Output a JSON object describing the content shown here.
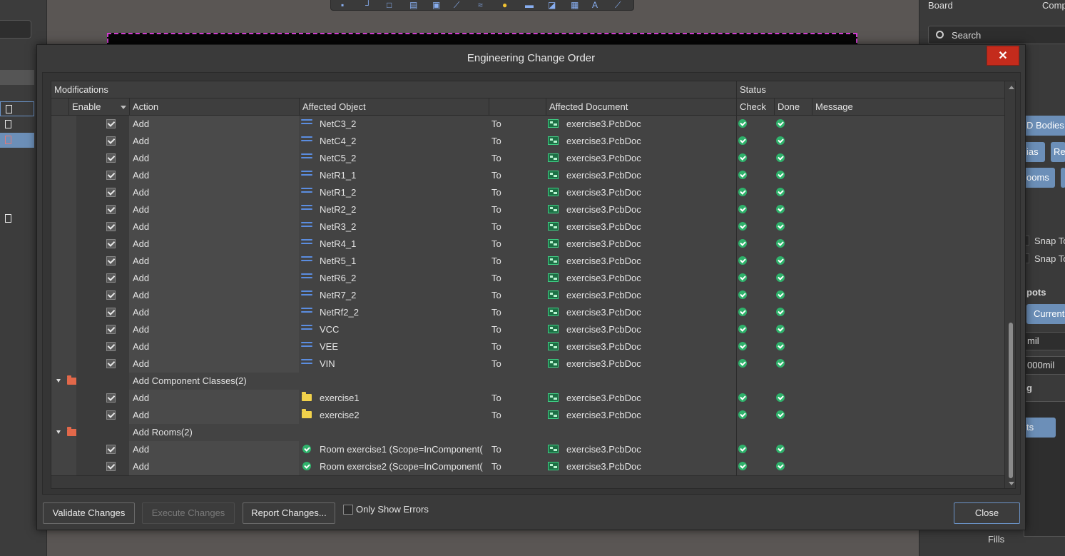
{
  "dialog": {
    "title": "Engineering Change Order",
    "close_x": "✕"
  },
  "columns": {
    "modifications": "Modifications",
    "status": "Status",
    "enable": "Enable",
    "action": "Action",
    "affected_object": "Affected Object",
    "affected_document": "Affected Document",
    "check": "Check",
    "done": "Done",
    "message": "Message"
  },
  "rows": [
    {
      "type": "item",
      "enabled": true,
      "action": "Add",
      "icon": "net-icon",
      "object": "NetC3_2",
      "to": "To",
      "document": "exercise3.PcbDoc",
      "check": "ok",
      "done": "ok"
    },
    {
      "type": "item",
      "enabled": true,
      "action": "Add",
      "icon": "net-icon",
      "object": "NetC4_2",
      "to": "To",
      "document": "exercise3.PcbDoc",
      "check": "ok",
      "done": "ok"
    },
    {
      "type": "item",
      "enabled": true,
      "action": "Add",
      "icon": "net-icon",
      "object": "NetC5_2",
      "to": "To",
      "document": "exercise3.PcbDoc",
      "check": "ok",
      "done": "ok"
    },
    {
      "type": "item",
      "enabled": true,
      "action": "Add",
      "icon": "net-icon",
      "object": "NetR1_1",
      "to": "To",
      "document": "exercise3.PcbDoc",
      "check": "ok",
      "done": "ok"
    },
    {
      "type": "item",
      "enabled": true,
      "action": "Add",
      "icon": "net-icon",
      "object": "NetR1_2",
      "to": "To",
      "document": "exercise3.PcbDoc",
      "check": "ok",
      "done": "ok"
    },
    {
      "type": "item",
      "enabled": true,
      "action": "Add",
      "icon": "net-icon",
      "object": "NetR2_2",
      "to": "To",
      "document": "exercise3.PcbDoc",
      "check": "ok",
      "done": "ok"
    },
    {
      "type": "item",
      "enabled": true,
      "action": "Add",
      "icon": "net-icon",
      "object": "NetR3_2",
      "to": "To",
      "document": "exercise3.PcbDoc",
      "check": "ok",
      "done": "ok"
    },
    {
      "type": "item",
      "enabled": true,
      "action": "Add",
      "icon": "net-icon",
      "object": "NetR4_1",
      "to": "To",
      "document": "exercise3.PcbDoc",
      "check": "ok",
      "done": "ok"
    },
    {
      "type": "item",
      "enabled": true,
      "action": "Add",
      "icon": "net-icon",
      "object": "NetR5_1",
      "to": "To",
      "document": "exercise3.PcbDoc",
      "check": "ok",
      "done": "ok"
    },
    {
      "type": "item",
      "enabled": true,
      "action": "Add",
      "icon": "net-icon",
      "object": "NetR6_2",
      "to": "To",
      "document": "exercise3.PcbDoc",
      "check": "ok",
      "done": "ok"
    },
    {
      "type": "item",
      "enabled": true,
      "action": "Add",
      "icon": "net-icon",
      "object": "NetR7_2",
      "to": "To",
      "document": "exercise3.PcbDoc",
      "check": "ok",
      "done": "ok"
    },
    {
      "type": "item",
      "enabled": true,
      "action": "Add",
      "icon": "net-icon",
      "object": "NetRf2_2",
      "to": "To",
      "document": "exercise3.PcbDoc",
      "check": "ok",
      "done": "ok"
    },
    {
      "type": "item",
      "enabled": true,
      "action": "Add",
      "icon": "net-icon",
      "object": "VCC",
      "to": "To",
      "document": "exercise3.PcbDoc",
      "check": "ok",
      "done": "ok"
    },
    {
      "type": "item",
      "enabled": true,
      "action": "Add",
      "icon": "net-icon",
      "object": "VEE",
      "to": "To",
      "document": "exercise3.PcbDoc",
      "check": "ok",
      "done": "ok"
    },
    {
      "type": "item",
      "enabled": true,
      "action": "Add",
      "icon": "net-icon",
      "object": "VIN",
      "to": "To",
      "document": "exercise3.PcbDoc",
      "check": "ok",
      "done": "ok"
    },
    {
      "type": "group",
      "label": "Add Component Classes(2)"
    },
    {
      "type": "item",
      "enabled": true,
      "action": "Add",
      "icon": "folder-icon",
      "object": "exercise1",
      "to": "To",
      "document": "exercise3.PcbDoc",
      "check": "ok",
      "done": "ok"
    },
    {
      "type": "item",
      "enabled": true,
      "action": "Add",
      "icon": "folder-icon",
      "object": "exercise2",
      "to": "To",
      "document": "exercise3.PcbDoc",
      "check": "ok",
      "done": "ok"
    },
    {
      "type": "group",
      "label": "Add Rooms(2)"
    },
    {
      "type": "item",
      "enabled": true,
      "action": "Add",
      "icon": "room-icon",
      "object": "Room exercise1 (Scope=InComponent(",
      "to": "To",
      "document": "exercise3.PcbDoc",
      "check": "ok",
      "done": "ok"
    },
    {
      "type": "item",
      "enabled": true,
      "action": "Add",
      "icon": "room-icon",
      "object": "Room exercise2 (Scope=InComponent(",
      "to": "To",
      "document": "exercise3.PcbDoc",
      "check": "ok",
      "done": "ok"
    }
  ],
  "footer": {
    "validate": "Validate Changes",
    "execute": "Execute Changes",
    "report": "Report Changes...",
    "only_errors": "Only Show Errors",
    "close": "Close"
  },
  "background": {
    "right_panel": {
      "title_board": "Board",
      "title_comp": "Comp",
      "search": "Search",
      "chip_bodies": "D Bodies",
      "chip_vias": "ias",
      "chip_re": "Re",
      "chip_rooms": "ooms",
      "snap1": "Snap To",
      "snap2": "Snap To",
      "hotspots": "pots",
      "current": "Current",
      "mil": "mil",
      "mil2": "000mil",
      "g": "g",
      "ts": "ts",
      "fills": "Fills"
    }
  },
  "colors": {
    "accent": "#6b93c7",
    "close_red": "#c42b1c",
    "ok_green": "#2fb26b",
    "net_blue": "#5b8de0"
  }
}
